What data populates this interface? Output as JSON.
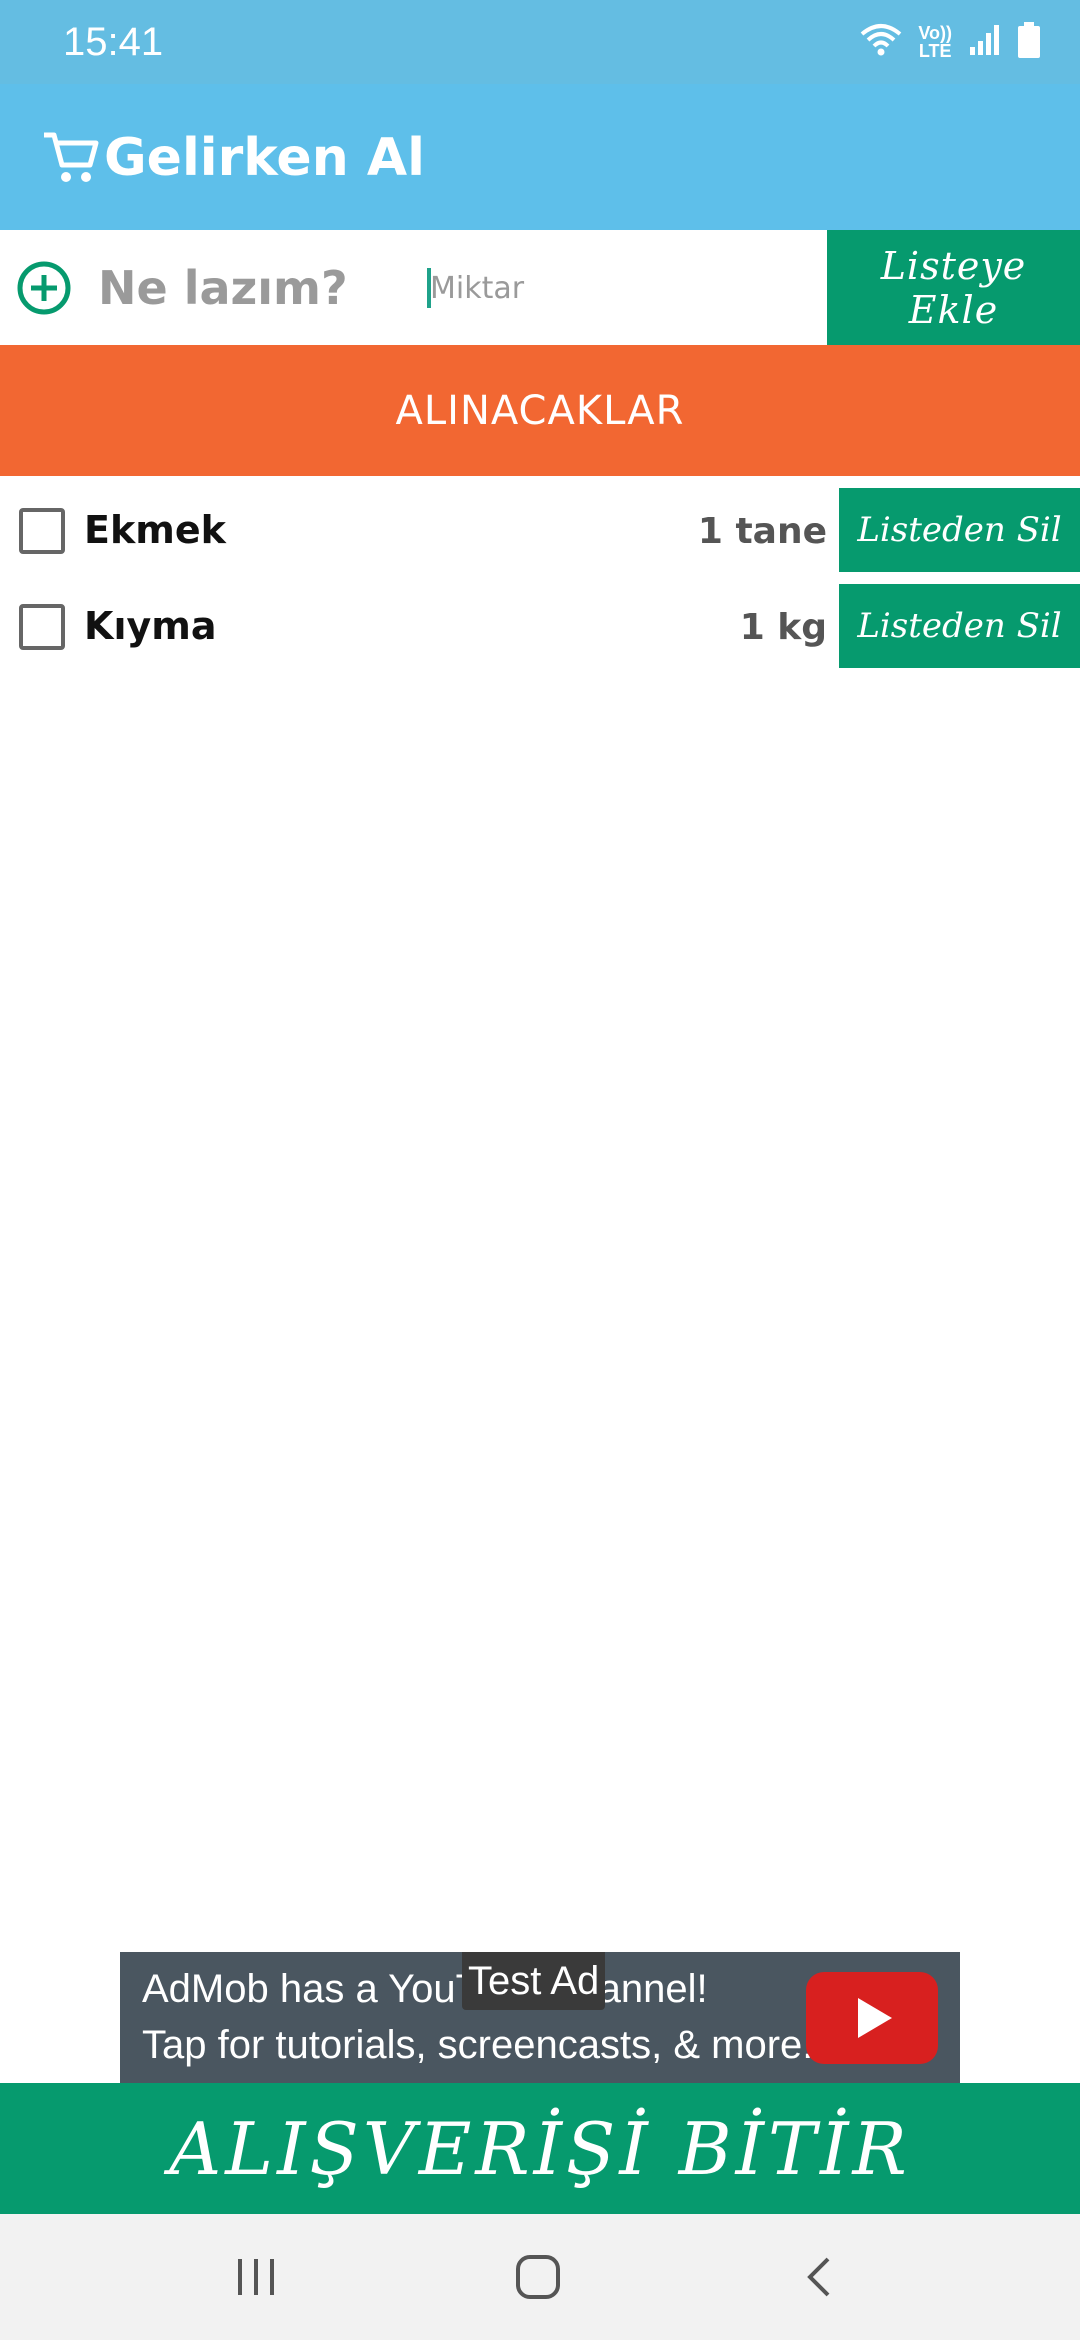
{
  "status_bar": {
    "time": "15:41",
    "lte_top": "Vo))",
    "lte_bottom": "LTE",
    "icons": [
      "wifi-icon",
      "signal-icon",
      "battery-icon"
    ]
  },
  "app_bar": {
    "title": "Gelirken Al",
    "icon": "cart-icon",
    "color": "#5ebfea"
  },
  "add_row": {
    "item_placeholder": "Ne lazım?",
    "quantity_placeholder": "Miktar",
    "add_button_label": "Listeye Ekle",
    "icon": "add-circle-icon"
  },
  "section": {
    "header": "ALINACAKLAR",
    "color": "#f26732"
  },
  "items": [
    {
      "name": "Ekmek",
      "quantity": "1 tane",
      "checked": false,
      "remove_label": "Listeden Sil"
    },
    {
      "name": "Kıyma",
      "quantity": "1 kg",
      "checked": false,
      "remove_label": "Listeden Sil"
    }
  ],
  "ad": {
    "badge": "Test Ad",
    "line1": "AdMob has a YouTube channel! ",
    "line2": "Tap for tutorials, screencasts, & more.",
    "icon": "youtube-play-icon"
  },
  "finish_button_label": "ALIŞVERİŞİ BİTİR",
  "accent_green": "#069a6e",
  "nav": {
    "icons": [
      "recent-apps-icon",
      "home-icon",
      "back-icon"
    ]
  }
}
